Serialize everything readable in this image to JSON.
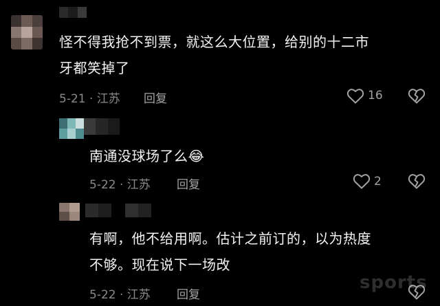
{
  "comments": [
    {
      "text_line1": "怪不得我抢不到票，就这么大位置，给别的十二市",
      "text_line2": "牙都笑掉了",
      "date_location": "5-21 · 江苏",
      "reply_label": "回复",
      "likes": "16"
    },
    {
      "text_line1": "南通没球场了么",
      "emoji": "😂",
      "date_location": "5-22 · 江苏",
      "reply_label": "回复",
      "likes": "2"
    },
    {
      "text_line1": "有啊，他不给用啊。估计之前订的，以为热度",
      "text_line2": "不够。现在说下一场改",
      "date_location": "5-22 · 江苏",
      "reply_label": "回复"
    }
  ],
  "watermark": "sports",
  "icons": [
    "heart-icon",
    "broken-heart-icon",
    "laughing-emoji-icon"
  ]
}
